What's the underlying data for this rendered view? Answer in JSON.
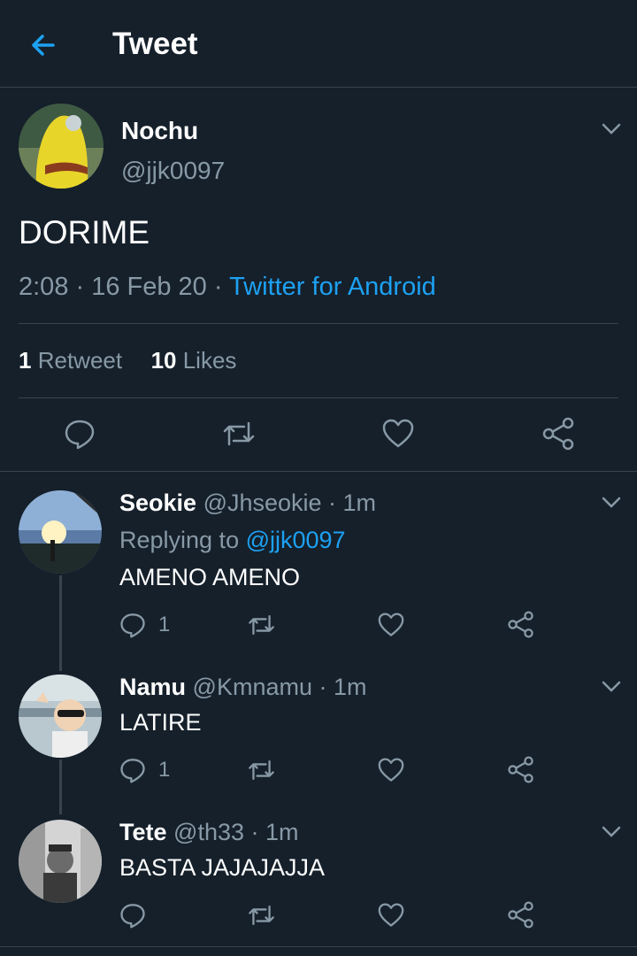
{
  "header": {
    "title": "Tweet",
    "back_icon": "arrow-left-icon",
    "accent": "#1da1f2"
  },
  "tweet": {
    "name": "Nochu",
    "handle": "@jjk0097",
    "text": "DORIME",
    "time": "2:08 · 16 Feb 20 · ",
    "source": "Twitter for Android",
    "retweet_count": "1",
    "retweet_label": "Retweet",
    "like_count": "10",
    "like_label": "Likes"
  },
  "replies": [
    {
      "name": "Seokie",
      "handle_time": "@Jhseokie · 1m",
      "replying_prefix": "Replying to ",
      "replying_to": "@jjk0097",
      "text": "AMENO AMENO",
      "reply_count": "1"
    },
    {
      "name": "Namu",
      "handle_time": "@Kmnamu · 1m",
      "text": "LATIRE",
      "reply_count": "1"
    },
    {
      "name": "Tete",
      "handle_time": "@th33 · 1m",
      "text": "BASTA JAJAJAJJA",
      "reply_count": ""
    }
  ],
  "colors": {
    "background": "#15202b",
    "divider": "#38444d",
    "secondary_text": "#8899a6",
    "link": "#1da1f2"
  }
}
